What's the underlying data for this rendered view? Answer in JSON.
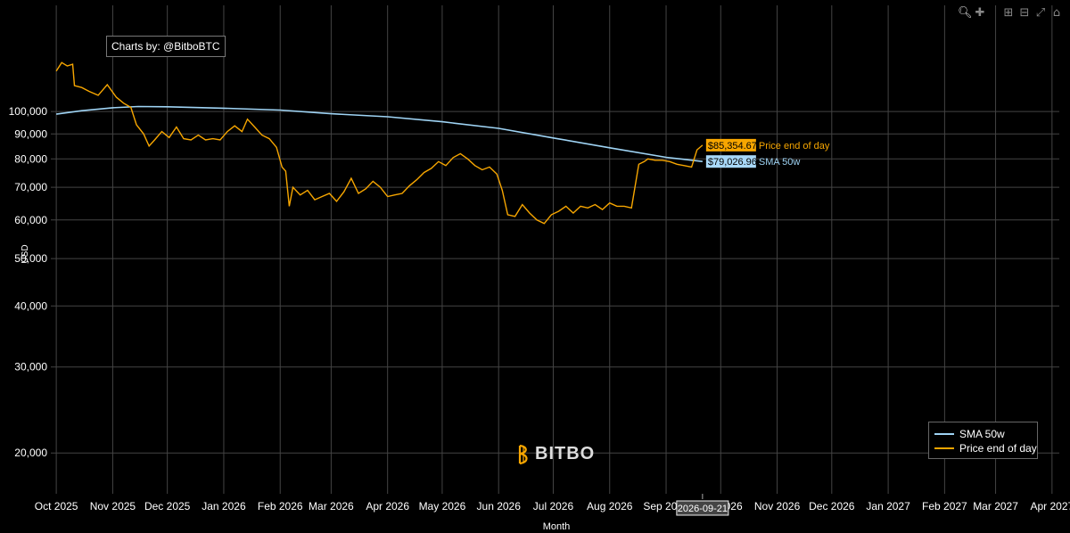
{
  "modebar": {
    "icons": [
      "zoom-icon",
      "pan-icon",
      "zoom-in-icon",
      "zoom-out-icon",
      "autoscale-icon",
      "reset-axes-icon"
    ]
  },
  "credit": "Charts by: @BitboBTC",
  "logo": {
    "text": "BITBO"
  },
  "hover": {
    "date": "2026-09-21",
    "price_label": "$85,354.67",
    "price_name": "Price end of day",
    "sma_label": "$79,026.96",
    "sma_name": "SMA 50w"
  },
  "colors": {
    "background": "#000000",
    "grid": "#444444",
    "sma": "#9fd4f5",
    "price": "#f7a600",
    "price_tag": "#f7a600",
    "sma_tag": "#a8d8f8"
  },
  "chart_data": {
    "type": "line",
    "xlabel": "Month",
    "ylabel": "USD",
    "y_scale": "log",
    "ylim": [
      16500,
      165000
    ],
    "xlim": [
      "2025-09-28",
      "2027-04-05"
    ],
    "x_ticks": [
      "2025-10-01",
      "2025-11-01",
      "2025-12-01",
      "2026-01-01",
      "2026-02-01",
      "2026-03-01",
      "2026-04-01",
      "2026-05-01",
      "2026-06-01",
      "2026-07-01",
      "2026-08-01",
      "2026-09-01",
      "2026-10-01",
      "2026-11-01",
      "2026-12-01",
      "2027-01-01",
      "2027-02-01",
      "2027-03-01",
      "2027-04-01"
    ],
    "x_tick_labels": [
      "Oct 2025",
      "Nov 2025",
      "Dec 2025",
      "Jan 2026",
      "Feb 2026",
      "Mar 2026",
      "Apr 2026",
      "May 2026",
      "Jun 2026",
      "Jul 2026",
      "Aug 2026",
      "Sep 2026",
      "Oct 2026",
      "Nov 2026",
      "Dec 2026",
      "Jan 2027",
      "Feb 2027",
      "Mar 2027",
      "Apr 2027"
    ],
    "y_ticks": [
      20000,
      30000,
      40000,
      50000,
      60000,
      70000,
      80000,
      90000,
      100000
    ],
    "y_tick_labels": [
      "20,000",
      "30,000",
      "40,000",
      "50,000",
      "60,000",
      "70,000",
      "80,000",
      "90,000",
      "100,000"
    ],
    "grid": true,
    "legend_position": "bottom-right",
    "series": [
      {
        "name": "SMA 50w",
        "color": "#9fd4f5",
        "x": [
          "2025-10-01",
          "2025-10-15",
          "2025-11-01",
          "2025-11-15",
          "2025-12-01",
          "2026-01-01",
          "2026-02-01",
          "2026-03-01",
          "2026-04-01",
          "2026-05-01",
          "2026-06-01",
          "2026-07-01",
          "2026-08-01",
          "2026-09-01",
          "2026-09-21"
        ],
        "y": [
          98800,
          100400,
          101800,
          102400,
          102300,
          101600,
          100700,
          99000,
          97600,
          95300,
          92400,
          88300,
          84300,
          80600,
          79027
        ]
      },
      {
        "name": "Price end of day",
        "color": "#f7a600",
        "x": [
          "2025-10-01",
          "2025-10-04",
          "2025-10-07",
          "2025-10-10",
          "2025-10-11",
          "2025-10-15",
          "2025-10-19",
          "2025-10-24",
          "2025-10-29",
          "2025-11-03",
          "2025-11-07",
          "2025-11-11",
          "2025-11-14",
          "2025-11-18",
          "2025-11-21",
          "2025-11-24",
          "2025-11-28",
          "2025-12-02",
          "2025-12-06",
          "2025-12-10",
          "2025-12-14",
          "2025-12-18",
          "2025-12-22",
          "2025-12-26",
          "2025-12-30",
          "2026-01-03",
          "2026-01-07",
          "2026-01-11",
          "2026-01-14",
          "2026-01-18",
          "2026-01-22",
          "2026-01-26",
          "2026-01-30",
          "2026-02-02",
          "2026-02-04",
          "2026-02-06",
          "2026-02-08",
          "2026-02-12",
          "2026-02-16",
          "2026-02-20",
          "2026-02-24",
          "2026-02-28",
          "2026-03-04",
          "2026-03-08",
          "2026-03-12",
          "2026-03-16",
          "2026-03-20",
          "2026-03-24",
          "2026-03-28",
          "2026-04-01",
          "2026-04-05",
          "2026-04-09",
          "2026-04-13",
          "2026-04-17",
          "2026-04-21",
          "2026-04-25",
          "2026-04-29",
          "2026-05-03",
          "2026-05-07",
          "2026-05-11",
          "2026-05-15",
          "2026-05-19",
          "2026-05-23",
          "2026-05-27",
          "2026-05-31",
          "2026-06-03",
          "2026-06-06",
          "2026-06-10",
          "2026-06-14",
          "2026-06-18",
          "2026-06-22",
          "2026-06-26",
          "2026-06-30",
          "2026-07-04",
          "2026-07-08",
          "2026-07-12",
          "2026-07-16",
          "2026-07-20",
          "2026-07-24",
          "2026-07-28",
          "2026-08-01",
          "2026-08-05",
          "2026-08-09",
          "2026-08-13",
          "2026-08-17",
          "2026-08-20",
          "2026-08-22",
          "2026-08-26",
          "2026-08-30",
          "2026-09-03",
          "2026-09-07",
          "2026-09-11",
          "2026-09-15",
          "2026-09-18",
          "2026-09-21"
        ],
        "y": [
          121000,
          126000,
          124000,
          125000,
          113000,
          112000,
          110000,
          108000,
          113500,
          107000,
          104000,
          102000,
          94000,
          90000,
          85000,
          87500,
          91000,
          88500,
          93000,
          88000,
          87500,
          89500,
          87500,
          88000,
          87500,
          91000,
          93500,
          91000,
          96500,
          93000,
          89500,
          88000,
          84500,
          77000,
          75500,
          64000,
          70000,
          67500,
          69000,
          66000,
          67000,
          68000,
          65500,
          68500,
          73000,
          68000,
          69500,
          72000,
          70000,
          67000,
          67500,
          68000,
          70500,
          72500,
          75000,
          76500,
          79000,
          77500,
          80500,
          82000,
          80000,
          77500,
          76000,
          77000,
          74500,
          69000,
          61500,
          61000,
          64500,
          62000,
          60000,
          59000,
          61500,
          62500,
          64000,
          62000,
          64000,
          63500,
          64500,
          63000,
          65000,
          64000,
          64000,
          63500,
          78000,
          79000,
          80000,
          79500,
          79500,
          79000,
          78000,
          77500,
          77000,
          83500,
          85355
        ]
      }
    ]
  }
}
